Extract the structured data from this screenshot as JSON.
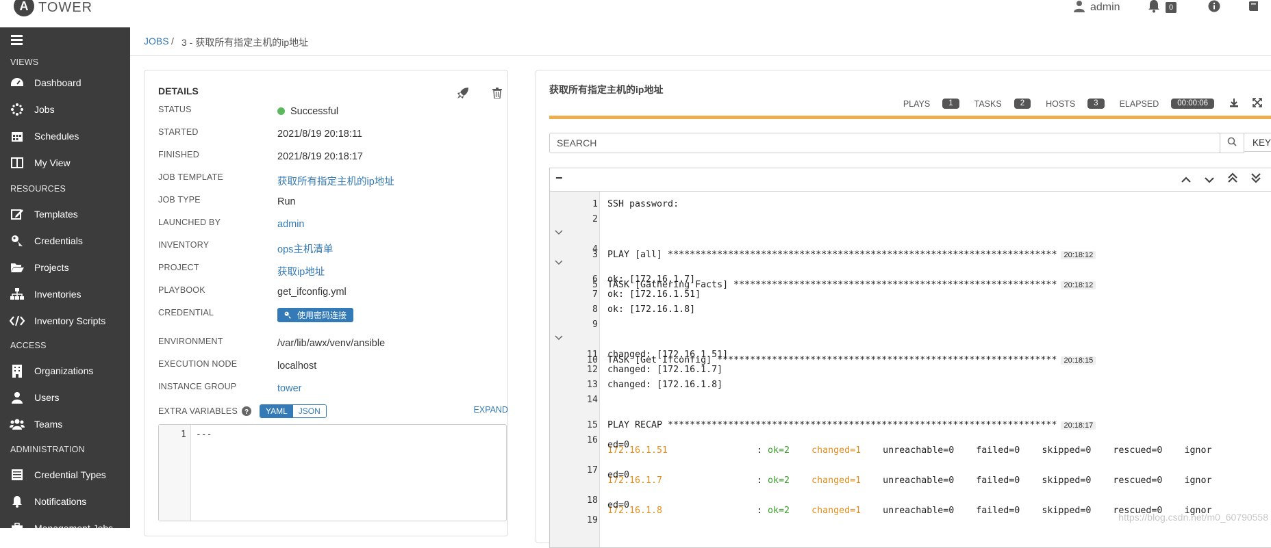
{
  "app": {
    "logo_letter": "A",
    "name": "TOWER"
  },
  "topbar": {
    "user": "admin",
    "notifications_count": "0"
  },
  "sidebar": {
    "sections": [
      {
        "title": "VIEWS",
        "items": [
          "Dashboard",
          "Jobs",
          "Schedules",
          "My View"
        ]
      },
      {
        "title": "RESOURCES",
        "items": [
          "Templates",
          "Credentials",
          "Projects",
          "Inventories",
          "Inventory Scripts"
        ]
      },
      {
        "title": "ACCESS",
        "items": [
          "Organizations",
          "Users",
          "Teams"
        ]
      },
      {
        "title": "ADMINISTRATION",
        "items": [
          "Credential Types",
          "Notifications",
          "Management Jobs"
        ]
      }
    ]
  },
  "breadcrumb": {
    "root": "JOBS",
    "separator": "/",
    "current": "3 - 获取所有指定主机的ip地址"
  },
  "details": {
    "title": "DETAILS",
    "status_label": "STATUS",
    "status_value": "Successful",
    "started_label": "STARTED",
    "started_value": "2021/8/19 20:18:11",
    "finished_label": "FINISHED",
    "finished_value": "2021/8/19 20:18:17",
    "job_template_label": "JOB TEMPLATE",
    "job_template_value": "获取所有指定主机的ip地址",
    "job_type_label": "JOB TYPE",
    "job_type_value": "Run",
    "launched_by_label": "LAUNCHED BY",
    "launched_by_value": "admin",
    "inventory_label": "INVENTORY",
    "inventory_value": "ops主机清单",
    "project_label": "PROJECT",
    "project_value": "获取ip地址",
    "playbook_label": "PLAYBOOK",
    "playbook_value": "get_ifconfig.yml",
    "credential_label": "CREDENTIAL",
    "credential_value": "使用密码连接",
    "environment_label": "ENVIRONMENT",
    "environment_value": "/var/lib/awx/venv/ansible",
    "execution_node_label": "EXECUTION NODE",
    "execution_node_value": "localhost",
    "instance_group_label": "INSTANCE GROUP",
    "instance_group_value": "tower",
    "extra_vars_label": "EXTRA VARIABLES",
    "yaml_label": "YAML",
    "json_label": "JSON",
    "expand_label": "EXPAND",
    "code_line_num": "1",
    "code_text": "---"
  },
  "output": {
    "title": "获取所有指定主机的ip地址",
    "plays_label": "PLAYS",
    "plays_count": "1",
    "tasks_label": "TASKS",
    "tasks_count": "2",
    "hosts_label": "HOSTS",
    "hosts_count": "3",
    "elapsed_label": "ELAPSED",
    "elapsed_value": "00:00:06",
    "search_placeholder": "SEARCH",
    "key_label": "KEY",
    "collapse_label": "−"
  },
  "log": {
    "l1": "SSH password:",
    "l3": "PLAY [all] ***********************************************************************",
    "l3_ts": "20:18:12",
    "l5": "TASK [Gathering Facts] ***********************************************************",
    "l5_ts": "20:18:12",
    "l6": "ok: [172.16.1.7]",
    "l7": "ok: [172.16.1.51]",
    "l8": "ok: [172.16.1.8]",
    "l10": "TASK [Get Ifconfig] **************************************************************",
    "l10_ts": "20:18:15",
    "l11": "changed: [172.16.1.51]",
    "l12": "changed: [172.16.1.7]",
    "l13": "changed: [172.16.1.8]",
    "l15": "PLAY RECAP ***********************************************************************",
    "l15_ts": "20:18:17",
    "r1_host": "172.16.1.51",
    "r2_host": "172.16.1.7",
    "r3_host": "172.16.1.8",
    "recap_colon": ": ",
    "recap_ok": "ok=2",
    "recap_changed": "changed=1",
    "recap_rest": "    unreachable=0    failed=0    skipped=0    rescued=0    ignor",
    "recap_wrap": "ed=0"
  },
  "watermark": "https://blog.csdn.net/m0_60790558"
}
